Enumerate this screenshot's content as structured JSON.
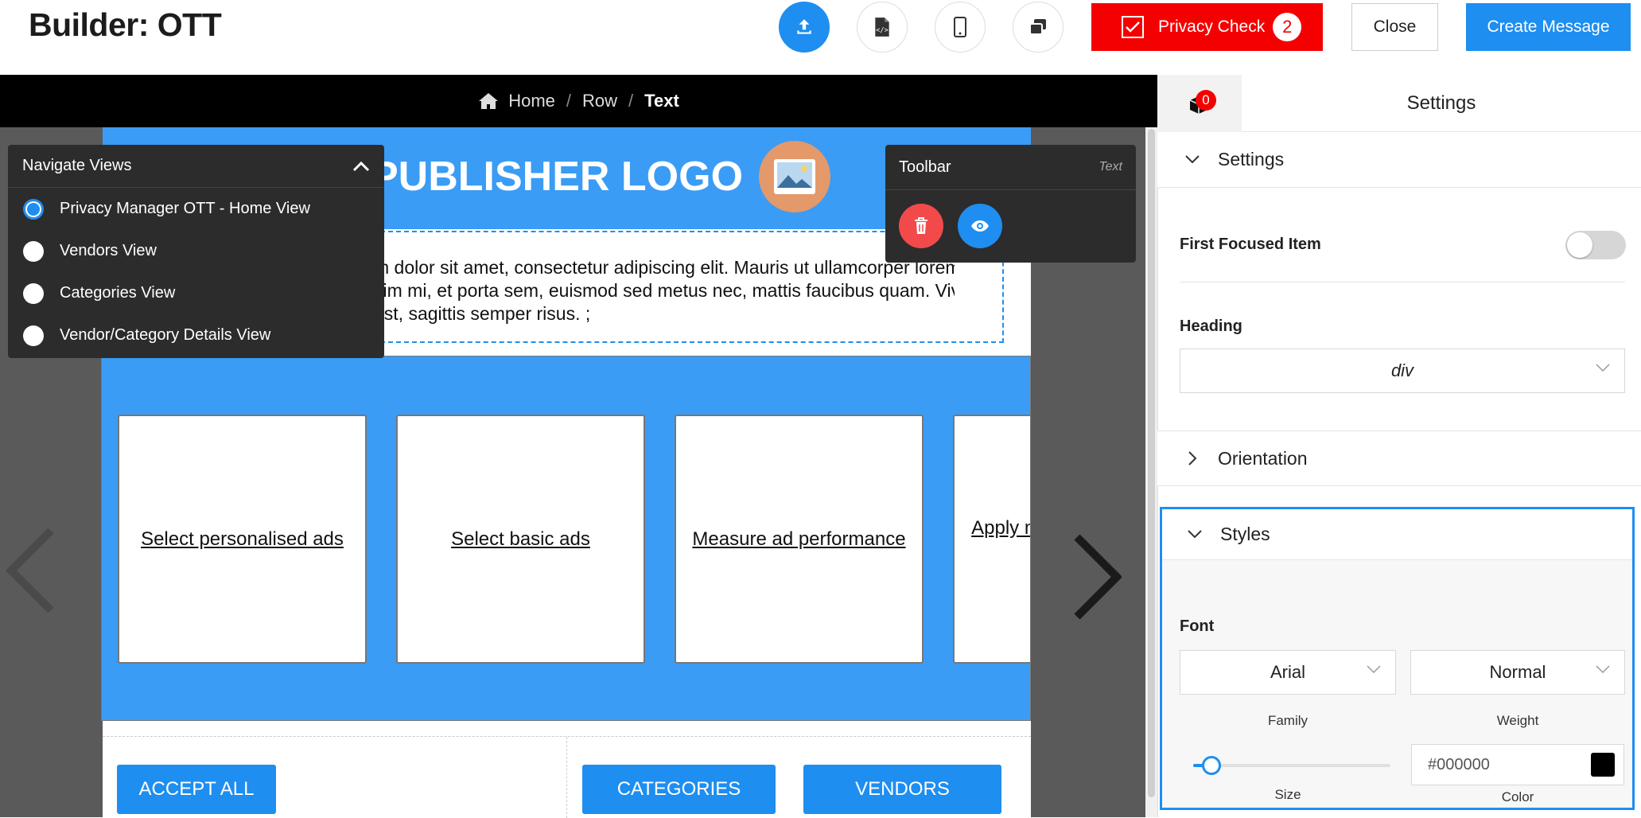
{
  "header": {
    "title": "Builder: OTT",
    "privacy_check_label": "Privacy Check",
    "privacy_check_count": "2",
    "close_label": "Close",
    "create_label": "Create Message",
    "icons": [
      "upload-icon",
      "code-file-icon",
      "mobile-icon",
      "layers-icon"
    ]
  },
  "breadcrumb": {
    "home": "Home",
    "row": "Row",
    "current": "Text",
    "separator": "/"
  },
  "canvas": {
    "logo_text": "PUBLISHER LOGO",
    "body_lines": [
      "m dolor sit amet, consectetur adipiscing elit. Mauris ut ullamcorper lorem. Mauris",
      "sim mi, et porta sem, euismod sed metus nec, mattis faucibus quam. Vivamus",
      "est, sagittis semper risus. ;"
    ],
    "cards": [
      "Select personalised ads",
      "Select basic ads",
      "Measure ad performance",
      "Apply market research to generate"
    ],
    "buttons": {
      "accept_all": "ACCEPT ALL",
      "categories": "CATEGORIES",
      "vendors": "VENDORS"
    }
  },
  "navigate_views": {
    "title": "Navigate Views",
    "items": [
      {
        "label": "Privacy Manager OTT - Home View",
        "selected": true
      },
      {
        "label": "Vendors View",
        "selected": false
      },
      {
        "label": "Categories View",
        "selected": false
      },
      {
        "label": "Vendor/Category Details View",
        "selected": false
      }
    ]
  },
  "toolbar": {
    "title": "Toolbar",
    "context": "Text"
  },
  "settings_panel": {
    "badge_count": "0",
    "tab_title": "Settings",
    "sections": {
      "settings": "Settings",
      "orientation": "Orientation",
      "styles": "Styles"
    },
    "first_focused_item_label": "First Focused Item",
    "first_focused_item_on": false,
    "heading_label": "Heading",
    "heading_value": "div",
    "font_label": "Font",
    "font_family": "Arial",
    "font_weight": "Normal",
    "family_caption": "Family",
    "weight_caption": "Weight",
    "size_caption": "Size",
    "color_caption": "Color",
    "color_value": "#000000",
    "font_size_fraction": 0.1
  },
  "colors": {
    "accent": "#1e8ef0",
    "danger": "#f50000",
    "logo_bg": "#3a9cf5"
  }
}
